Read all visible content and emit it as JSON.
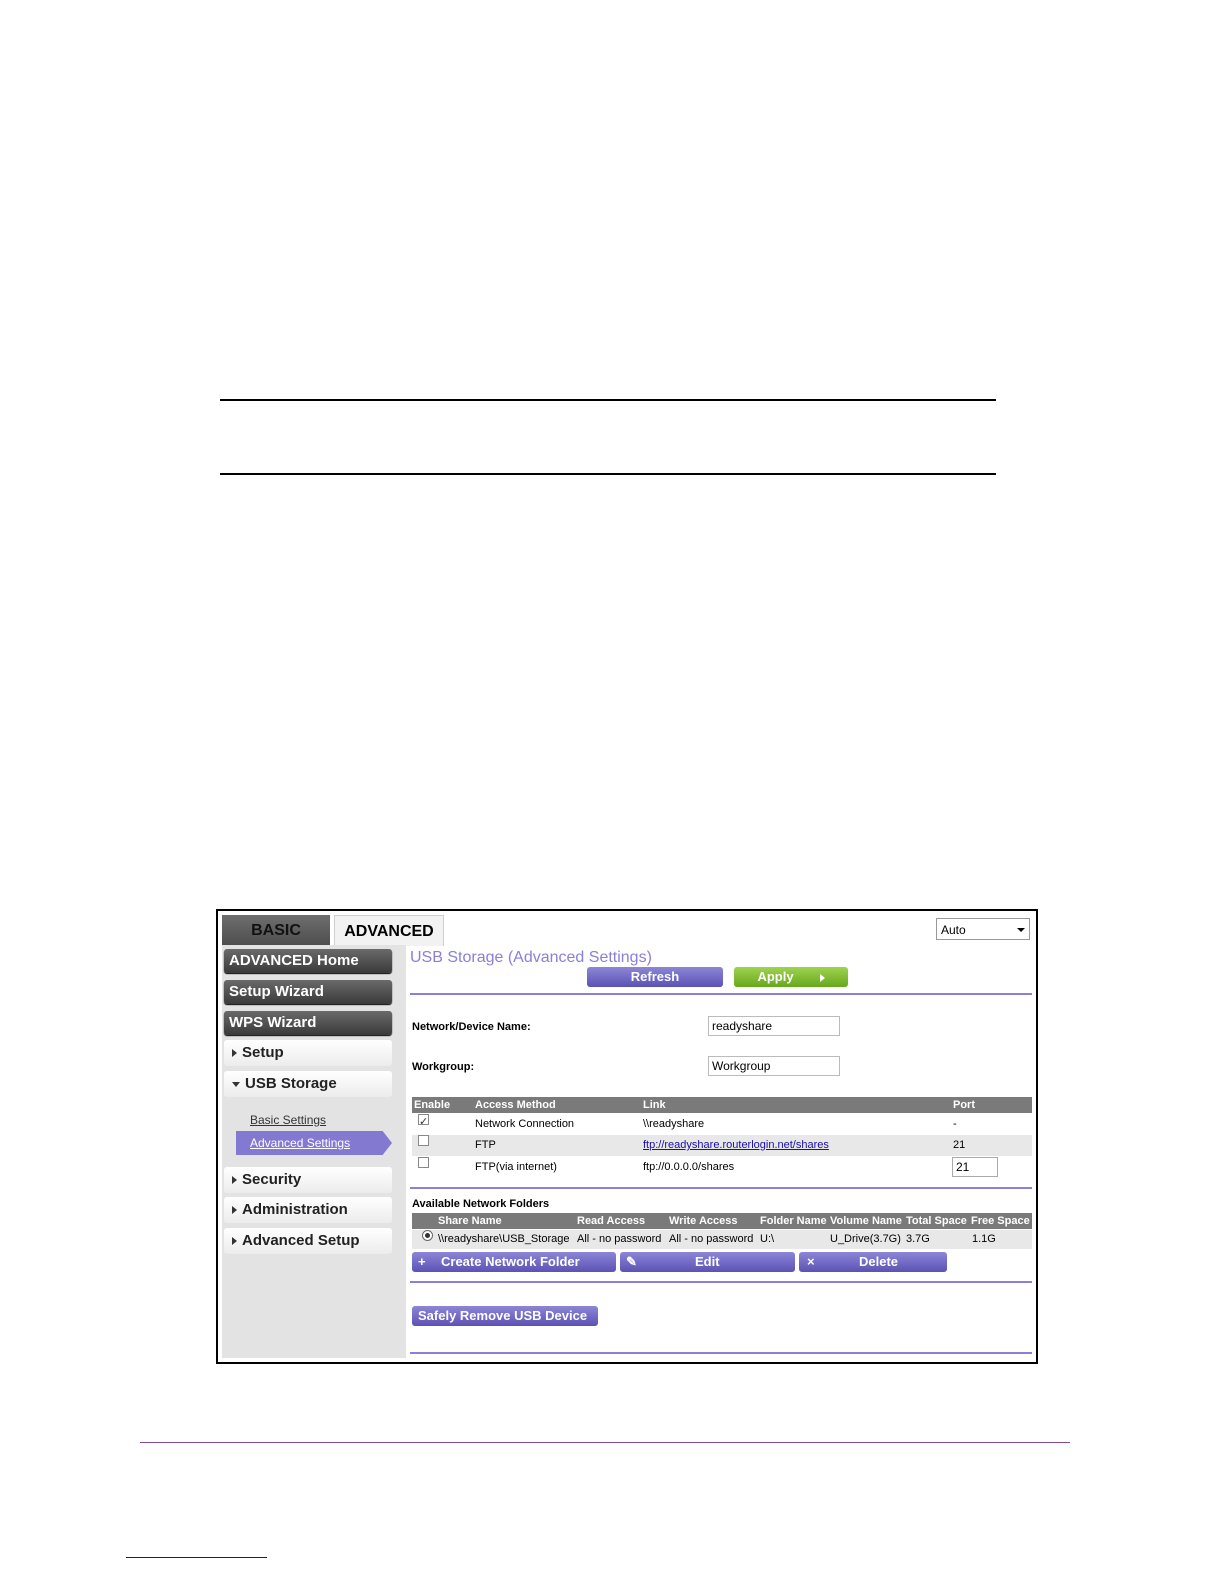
{
  "tabs": {
    "basic": "BASIC",
    "advanced": "ADVANCED"
  },
  "language": {
    "selected": "Auto"
  },
  "sidebar": {
    "advanced_home": "ADVANCED Home",
    "setup_wizard": "Setup Wizard",
    "wps_wizard": "WPS Wizard",
    "setup": "Setup",
    "usb_storage": "USB Storage",
    "basic_settings": "Basic Settings",
    "advanced_settings": "Advanced Settings",
    "security": "Security",
    "administration": "Administration",
    "advanced_setup": "Advanced Setup"
  },
  "main": {
    "title": "USB Storage (Advanced Settings)",
    "refresh": "Refresh",
    "apply": "Apply",
    "device_name_label": "Network/Device Name:",
    "device_name_value": "readyshare",
    "workgroup_label": "Workgroup:",
    "workgroup_value": "Workgroup"
  },
  "access_table": {
    "headers": {
      "enable": "Enable",
      "method": "Access Method",
      "link": "Link",
      "port": "Port"
    },
    "rows": [
      {
        "enabled": true,
        "method": "Network Connection",
        "link": "\\\\readyshare",
        "port": "-"
      },
      {
        "enabled": false,
        "method": "FTP",
        "link": "ftp://readyshare.routerlogin.net/shares",
        "port": "21"
      },
      {
        "enabled": false,
        "method": "FTP(via internet)",
        "link": "ftp://0.0.0.0/shares",
        "port": "21"
      }
    ]
  },
  "folders": {
    "title": "Available Network Folders",
    "headers": {
      "share_name": "Share Name",
      "read_access": "Read Access",
      "write_access": "Write Access",
      "folder_name": "Folder Name",
      "volume_name": "Volume Name",
      "total_space": "Total Space",
      "free_space": "Free Space"
    },
    "row": {
      "share_name": "\\\\readyshare\\USB_Storage",
      "read_access": "All - no password",
      "write_access": "All - no password",
      "folder_name": "U:\\",
      "volume_name": "U_Drive(3.7G)",
      "total_space": "3.7G",
      "free_space": "1.1G"
    },
    "create": "Create Network Folder",
    "edit": "Edit",
    "delete": "Delete",
    "safely_remove": "Safely Remove USB Device"
  }
}
